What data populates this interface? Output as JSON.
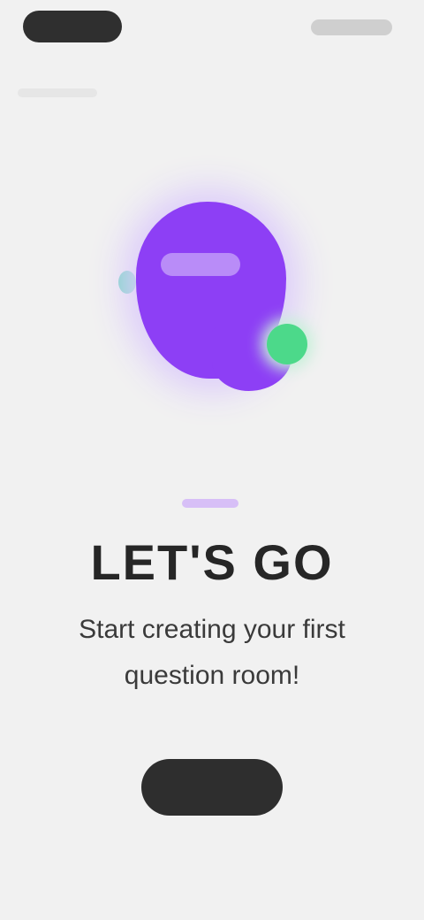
{
  "header": {
    "left_pill_label": "",
    "right_pill_label": ""
  },
  "hero": {
    "badge_text": ""
  },
  "main": {
    "headline": "LET'S GO",
    "subtitle": "Start creating your first question room!"
  },
  "cta": {
    "label": ""
  },
  "colors": {
    "background": "#f1f1f1",
    "brand_purple": "#8d3ff5",
    "accent_green": "#4cd98a",
    "button_dark": "#2e2e2e"
  },
  "icons": {
    "hero": "speech-bubble-logo",
    "decor_dot": "green-dot"
  }
}
